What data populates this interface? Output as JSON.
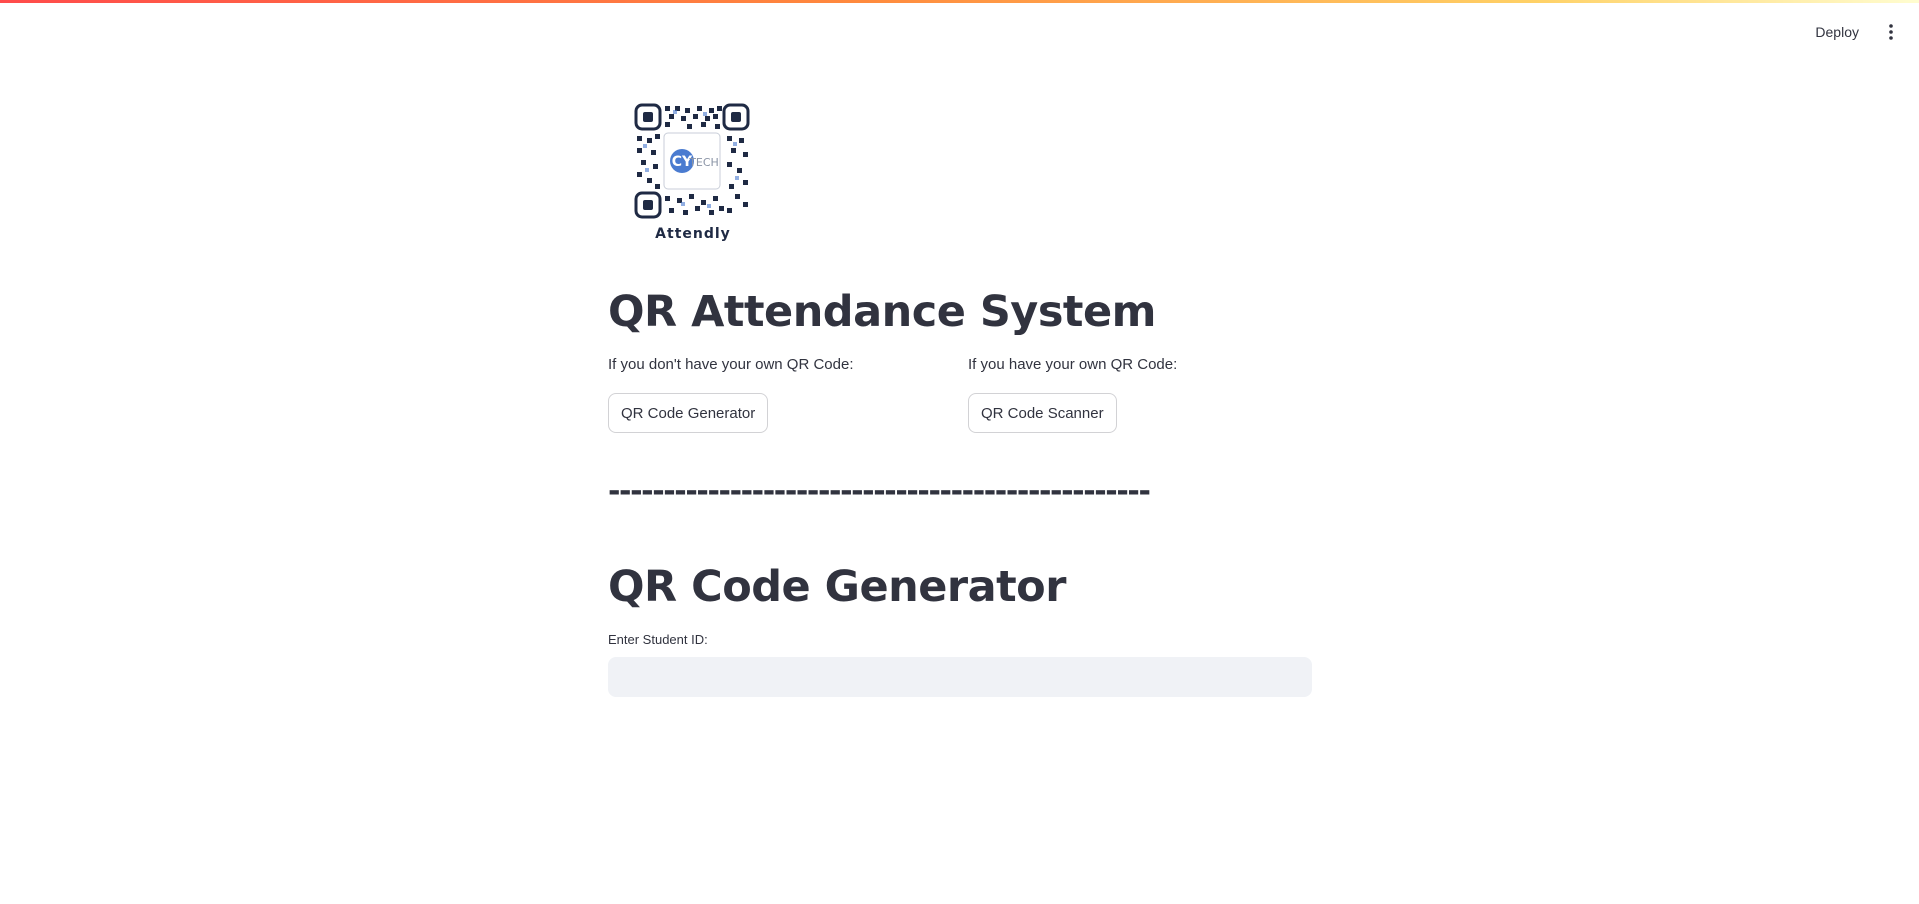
{
  "header": {
    "deploy_label": "Deploy",
    "menu_icon": "kebab-menu-icon",
    "accent_gradient": [
      "#ff4b4b",
      "#ff8a3d",
      "#ffd166",
      "#fffdd0"
    ]
  },
  "logo": {
    "caption": "Attendly",
    "center_mark": "CY",
    "center_text": "TECH",
    "icon": "qr-code-logo"
  },
  "main": {
    "title": "QR Attendance System",
    "left_column": {
      "label": "If you don't have your own QR Code:",
      "button_label": "QR Code Generator"
    },
    "right_column": {
      "label": "If you have your own QR Code:",
      "button_label": "QR Code Scanner"
    },
    "divider": "-------------------------------------------------"
  },
  "generator": {
    "title": "QR Code Generator",
    "input_label": "Enter Student ID:",
    "input_value": ""
  },
  "colors": {
    "text": "#31333f",
    "input_bg": "#f0f2f6",
    "logo_navy": "#1f2a44",
    "logo_blue": "#4a7bd0"
  }
}
